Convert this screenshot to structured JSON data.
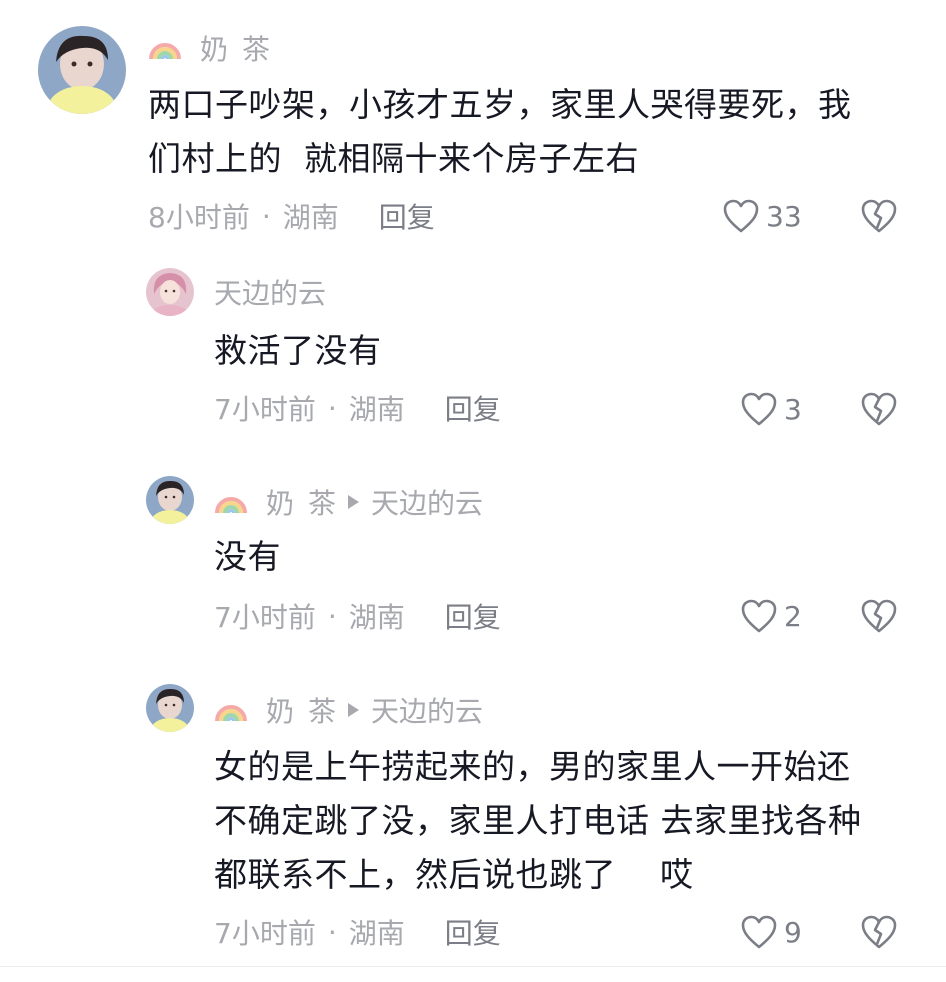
{
  "comments": [
    {
      "username": "奶茶",
      "body_lines": [
        "两口子吵架，小孩才五岁，家里人哭得要死，我",
        "们村上的  就相隔十来个房子左右"
      ],
      "time": "8小时前",
      "dot": "·",
      "location": "湖南",
      "reply_label": "回复",
      "likes": "33"
    },
    {
      "username": "天边的云",
      "body_lines": [
        "救活了没有"
      ],
      "time": "7小时前",
      "dot": "·",
      "location": "湖南",
      "reply_label": "回复",
      "likes": "3"
    },
    {
      "username": "奶茶",
      "reply_to": "天边的云",
      "body_lines": [
        "没有"
      ],
      "time": "7小时前",
      "dot": "·",
      "location": "湖南",
      "reply_label": "回复",
      "likes": "2"
    },
    {
      "username": "奶茶",
      "reply_to": "天边的云",
      "body_lines": [
        "女的是上午捞起来的，男的家里人一开始还",
        "不确定跳了没，家里人打电话 去家里找各种",
        "都联系不上，然后说也跳了    哎"
      ],
      "time": "7小时前",
      "dot": "·",
      "location": "湖南",
      "reply_label": "回复",
      "likes": "9"
    }
  ],
  "icons": {
    "rainbow": "rainbow-icon",
    "like": "heart-outline-icon",
    "dislike": "broken-heart-icon",
    "reply_arrow": "triangle-right-icon"
  },
  "colors": {
    "text": "#161823",
    "muted": "#a7a9ae",
    "action": "#7b7e86"
  }
}
